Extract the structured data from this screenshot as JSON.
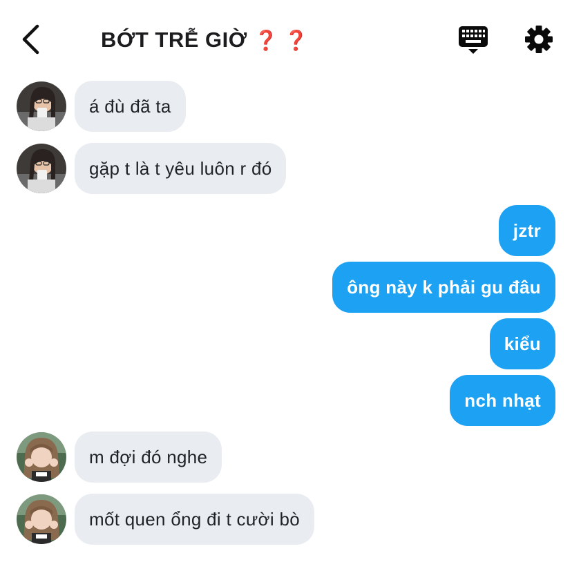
{
  "header": {
    "title": "BỚT TRỄ GIỜ",
    "title_marks": "❓ ❓",
    "back_icon": "chevron-left-icon",
    "keyboard_icon": "keyboard-icon",
    "settings_icon": "gear-icon"
  },
  "colors": {
    "outgoing_bubble": "#1da1f2",
    "incoming_bubble": "#e9ecf0",
    "question_mark": "#e0252b"
  },
  "messages": [
    {
      "direction": "incoming",
      "text": "á đù đã ta"
    },
    {
      "direction": "incoming",
      "text": "gặp t là t yêu luôn r đó"
    },
    {
      "direction": "outgoing",
      "text": "jztr"
    },
    {
      "direction": "outgoing",
      "text": "ông này k phải gu đâu"
    },
    {
      "direction": "outgoing",
      "text": "kiểu"
    },
    {
      "direction": "outgoing",
      "text": "nch nhạt"
    },
    {
      "direction": "incoming",
      "text": "m đợi đó nghe"
    },
    {
      "direction": "incoming",
      "text": "mốt quen ổng đi t cười bò"
    }
  ]
}
